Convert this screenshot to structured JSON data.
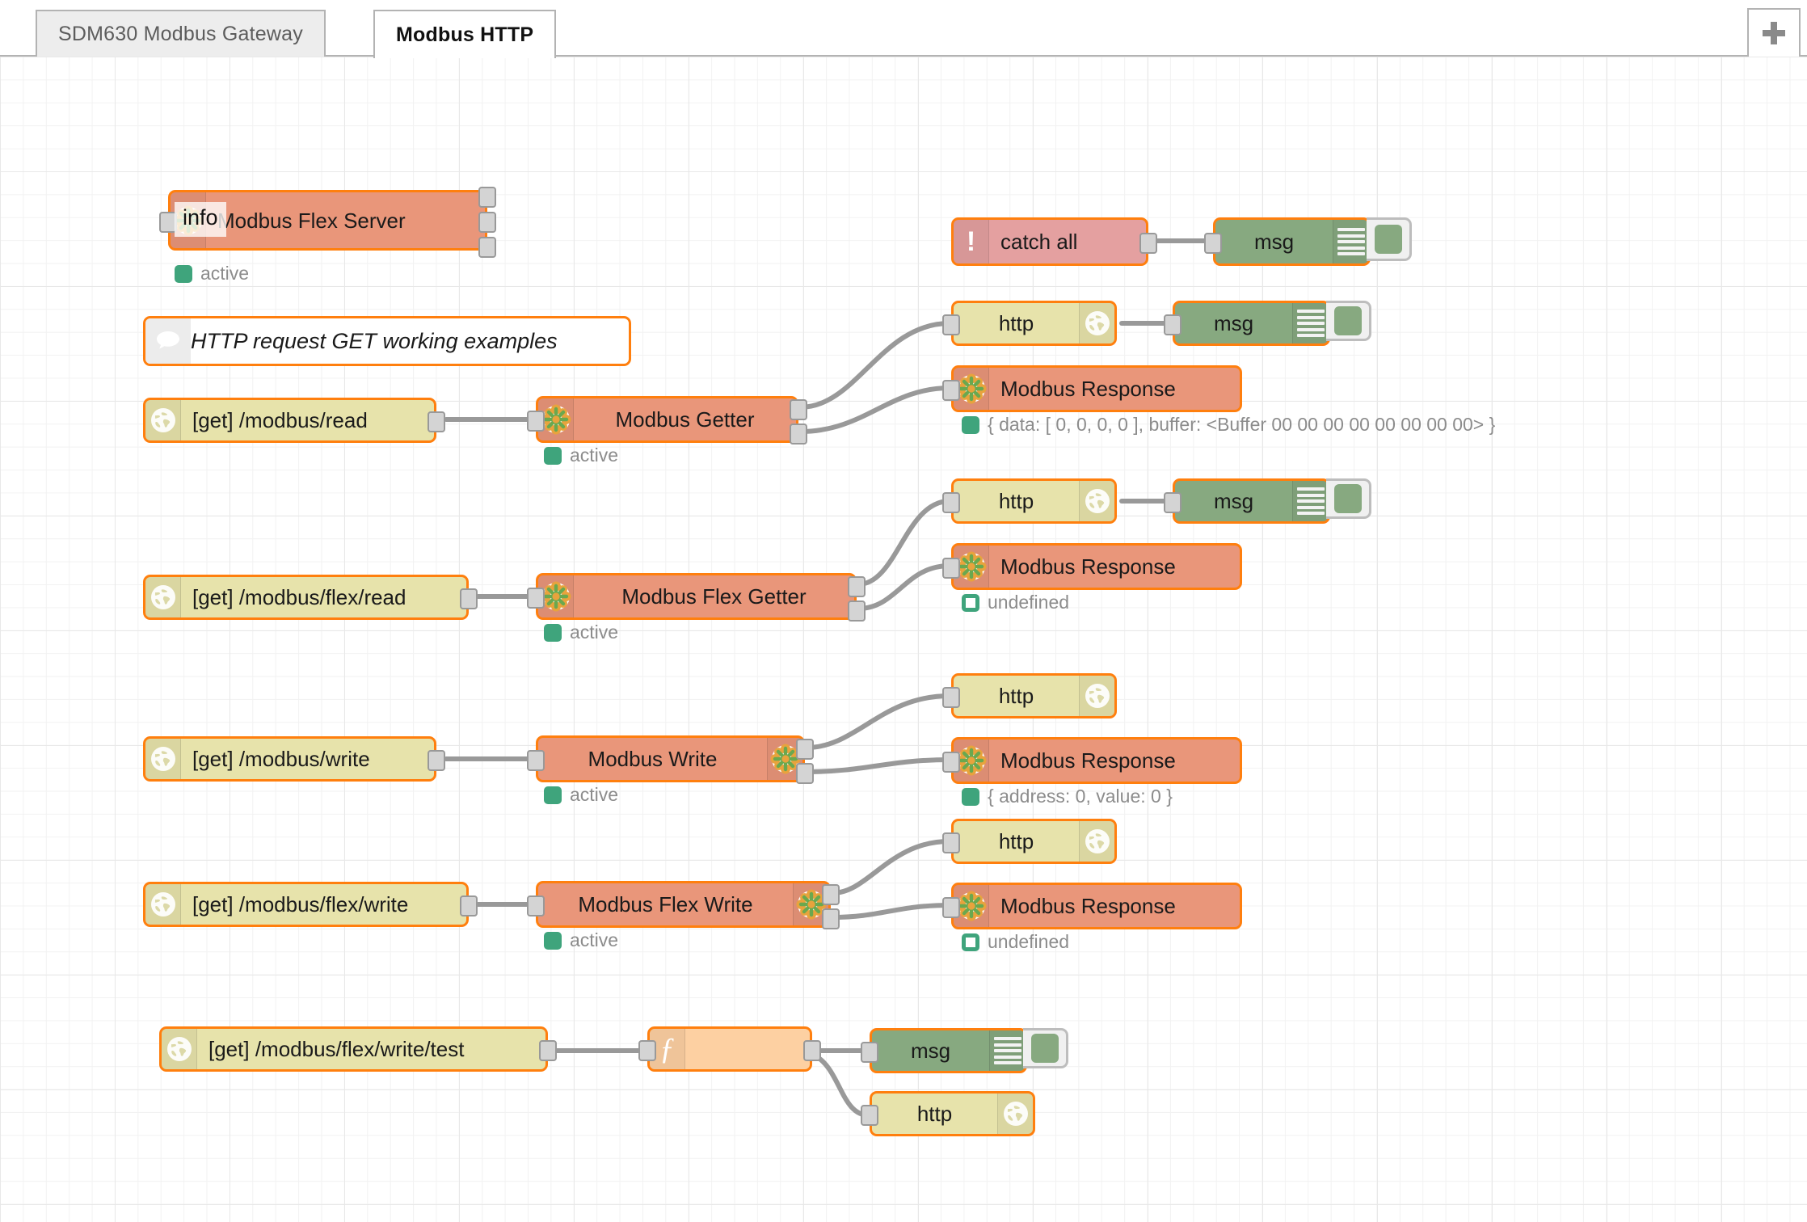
{
  "tabs": [
    {
      "label": "SDM630 Modbus Gateway",
      "active": false
    },
    {
      "label": "Modbus HTTP",
      "active": true
    }
  ],
  "add_tab_icon": "plus-icon",
  "tooltip": {
    "text": "info"
  },
  "nodes": {
    "modbus_flex_server": {
      "label": "Modbus Flex Server",
      "icon": "modbus-icon",
      "status": "active",
      "status_type": "filled"
    },
    "comment": {
      "label": "HTTP request GET working examples",
      "icon": "comment-bubble-icon"
    },
    "catch_all": {
      "label": "catch all",
      "icon": "exclamation-icon"
    },
    "debug_catch": {
      "label": "msg",
      "icon": "debug-bars-icon"
    },
    "http_in_read": {
      "label": "[get] /modbus/read",
      "icon": "globe-icon"
    },
    "modbus_getter": {
      "label": "Modbus Getter",
      "icon": "modbus-icon",
      "status": "active",
      "status_type": "filled"
    },
    "http_resp_1": {
      "label": "http",
      "icon": "globe-icon"
    },
    "debug_1": {
      "label": "msg",
      "icon": "debug-bars-icon"
    },
    "modbus_response_1": {
      "label": "Modbus Response",
      "icon": "modbus-icon",
      "status": "{ data: [ 0, 0, 0, 0 ], buffer: <Buffer 00 00 00 00 00 00 00 00> }",
      "status_type": "filled"
    },
    "http_in_flex_read": {
      "label": "[get] /modbus/flex/read",
      "icon": "globe-icon"
    },
    "modbus_flex_getter": {
      "label": "Modbus Flex Getter",
      "icon": "modbus-icon",
      "status": "active",
      "status_type": "filled"
    },
    "http_resp_2": {
      "label": "http",
      "icon": "globe-icon"
    },
    "debug_2": {
      "label": "msg",
      "icon": "debug-bars-icon"
    },
    "modbus_response_2": {
      "label": "Modbus Response",
      "icon": "modbus-icon",
      "status": "undefined",
      "status_type": "ring"
    },
    "http_in_write": {
      "label": "[get] /modbus/write",
      "icon": "globe-icon"
    },
    "modbus_write": {
      "label": "Modbus Write",
      "icon": "modbus-icon",
      "status": "active",
      "status_type": "filled"
    },
    "http_resp_3": {
      "label": "http",
      "icon": "globe-icon"
    },
    "modbus_response_3": {
      "label": "Modbus Response",
      "icon": "modbus-icon",
      "status": "{ address: 0, value: 0 }",
      "status_type": "filled"
    },
    "http_in_flex_write": {
      "label": "[get] /modbus/flex/write",
      "icon": "globe-icon"
    },
    "modbus_flex_write": {
      "label": "Modbus Flex Write",
      "icon": "modbus-icon",
      "status": "active",
      "status_type": "filled"
    },
    "http_resp_4": {
      "label": "http",
      "icon": "globe-icon"
    },
    "modbus_response_4": {
      "label": "Modbus Response",
      "icon": "modbus-icon",
      "status": "undefined",
      "status_type": "ring"
    },
    "http_in_flex_write_test": {
      "label": "[get] /modbus/flex/write/test",
      "icon": "globe-icon"
    },
    "function_node": {
      "label": "",
      "icon": "function-icon"
    },
    "debug_3": {
      "label": "msg",
      "icon": "debug-bars-icon"
    },
    "http_resp_5": {
      "label": "http",
      "icon": "globe-icon"
    }
  },
  "colors": {
    "node_border": "#ff7f0e",
    "modbus": "#e9967a",
    "http": "#e7e3ab",
    "debug": "#87a980",
    "catch": "#e4a0a0",
    "function": "#fdd0a2",
    "status_green": "#3fa47c",
    "wire": "#999999"
  }
}
